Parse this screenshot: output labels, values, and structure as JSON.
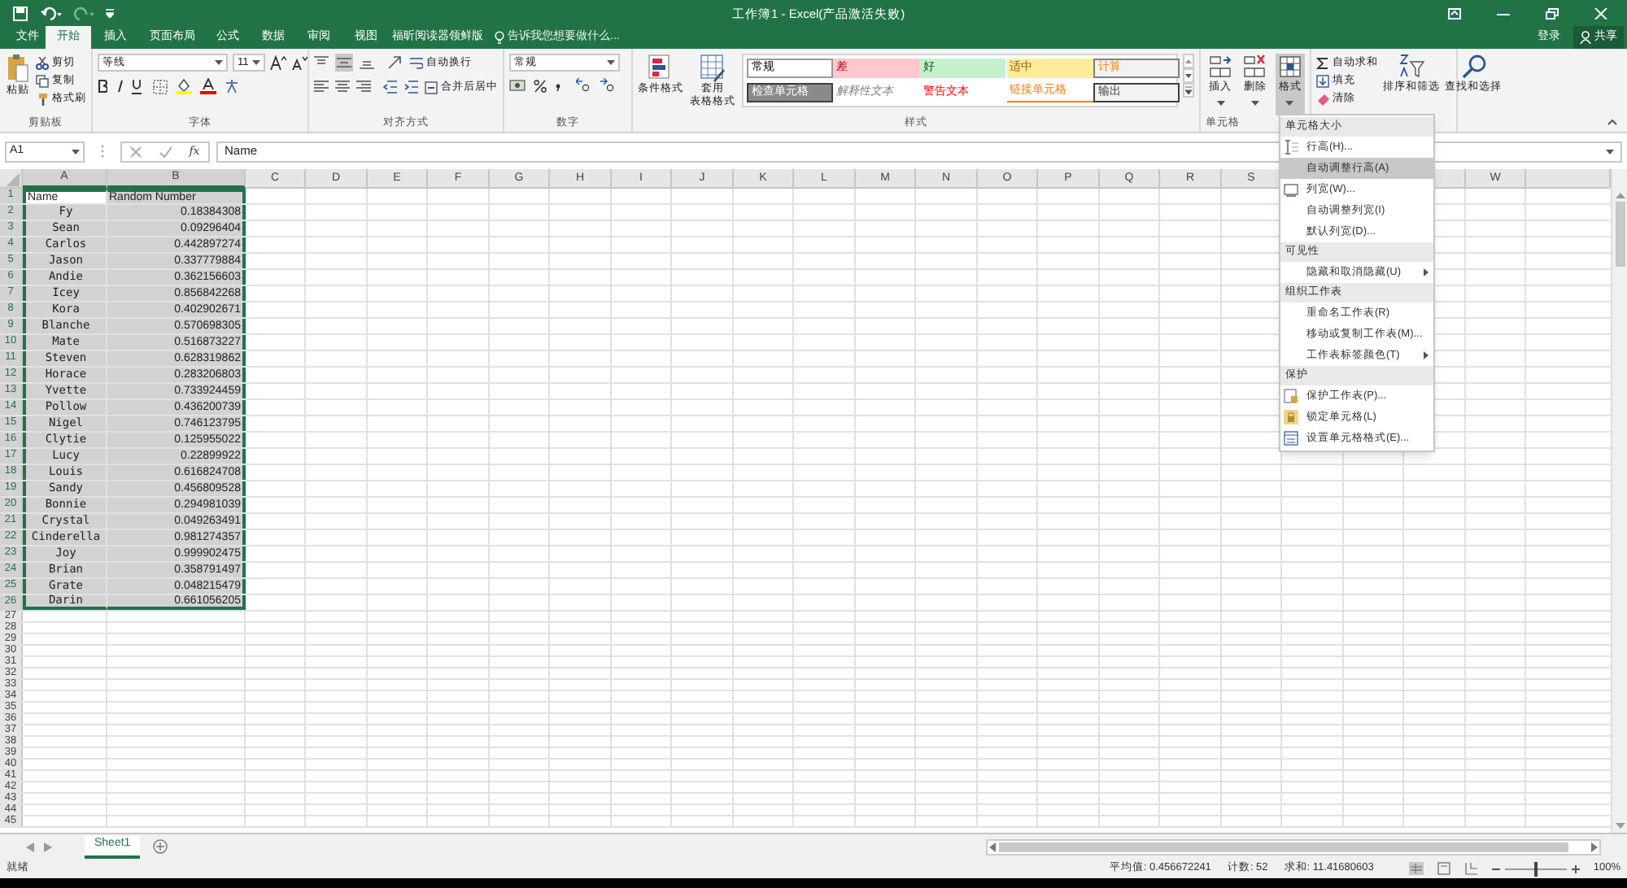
{
  "title_bar": {
    "title": "工作簿1 - Excel(产品激活失败)"
  },
  "menu_tabs": [
    {
      "label": "文件",
      "selected": false
    },
    {
      "label": "开始",
      "selected": true
    },
    {
      "label": "插入",
      "selected": false
    },
    {
      "label": "页面布局",
      "selected": false
    },
    {
      "label": "公式",
      "selected": false
    },
    {
      "label": "数据",
      "selected": false
    },
    {
      "label": "审阅",
      "selected": false
    },
    {
      "label": "视图",
      "selected": false
    },
    {
      "label": "福昕阅读器领鲜版",
      "selected": false
    }
  ],
  "tell_me": {
    "placeholder": "告诉我您想要做什么..."
  },
  "account": {
    "sign_in": "登录",
    "share": "共享"
  },
  "ribbon": {
    "clipboard": {
      "paste": "粘贴",
      "cut": "剪切",
      "copy": "复制",
      "format_painter": "格式刷",
      "label": "剪贴板"
    },
    "font": {
      "font_name": "等线",
      "font_size": "11",
      "label": "字体"
    },
    "alignment": {
      "wrap": "自动换行",
      "merge": "合并后居中",
      "label": "对齐方式"
    },
    "number": {
      "format": "常规",
      "label": "数字"
    },
    "styles": {
      "conditional": "条件格式",
      "table_format": [
        "套用",
        "表格格式"
      ],
      "label": "样式",
      "cell_styles": [
        {
          "label": "常规",
          "kind": "normal"
        },
        {
          "label": "差",
          "kind": "bad"
        },
        {
          "label": "好",
          "kind": "good"
        },
        {
          "label": "适中",
          "kind": "neutral"
        },
        {
          "label": "计算",
          "kind": "calculation"
        },
        {
          "label": "检查单元格",
          "kind": "check"
        },
        {
          "label": "解释性文本",
          "kind": "explanatory"
        },
        {
          "label": "警告文本",
          "kind": "warning"
        },
        {
          "label": "链接单元格",
          "kind": "linked"
        },
        {
          "label": "输出",
          "kind": "output"
        }
      ]
    },
    "cells": {
      "insert": "插入",
      "delete": "删除",
      "format": "格式",
      "label": "单元格"
    },
    "editing": {
      "autosum": "自动求和",
      "fill": "填充",
      "clear": "清除",
      "sort": "排序和筛选",
      "find": "查找和选择"
    }
  },
  "formula_bar": {
    "name_box": "A1",
    "fx": "fx",
    "value": "Name"
  },
  "sheet": {
    "columns": [
      "A",
      "B",
      "C",
      "D",
      "E",
      "F",
      "G",
      "H",
      "I",
      "J",
      "K",
      "L",
      "M",
      "N",
      "O",
      "P",
      "Q",
      "R",
      "S"
    ],
    "columns_right": [
      "W"
    ],
    "rows": [
      {
        "number": "1",
        "cells": [
          "Name",
          "Random Number"
        ],
        "selected": true
      },
      {
        "number": "2",
        "cells": [
          "Fy",
          "0.18384308"
        ],
        "selected": true
      },
      {
        "number": "3",
        "cells": [
          "Sean",
          "0.09296404"
        ],
        "selected": true
      },
      {
        "number": "4",
        "cells": [
          "Carlos",
          "0.442897274"
        ],
        "selected": true
      },
      {
        "number": "5",
        "cells": [
          "Jason",
          "0.337779884"
        ],
        "selected": true
      },
      {
        "number": "6",
        "cells": [
          "Andie",
          "0.362156603"
        ],
        "selected": true
      },
      {
        "number": "7",
        "cells": [
          "Icey",
          "0.856842268"
        ],
        "selected": true
      },
      {
        "number": "8",
        "cells": [
          "Kora",
          "0.402902671"
        ],
        "selected": true
      },
      {
        "number": "9",
        "cells": [
          "Blanche",
          "0.570698305"
        ],
        "selected": true
      },
      {
        "number": "10",
        "cells": [
          "Mate",
          "0.516873227"
        ],
        "selected": true
      },
      {
        "number": "11",
        "cells": [
          "Steven",
          "0.628319862"
        ],
        "selected": true
      },
      {
        "number": "12",
        "cells": [
          "Horace",
          "0.283206803"
        ],
        "selected": true
      },
      {
        "number": "13",
        "cells": [
          "Yvette",
          "0.733924459"
        ],
        "selected": true
      },
      {
        "number": "14",
        "cells": [
          "Pollow",
          "0.436200739"
        ],
        "selected": true
      },
      {
        "number": "15",
        "cells": [
          "Nigel",
          "0.746123795"
        ],
        "selected": true
      },
      {
        "number": "16",
        "cells": [
          "Clytie",
          "0.125955022"
        ],
        "selected": true
      },
      {
        "number": "17",
        "cells": [
          "Lucy",
          "0.22899922"
        ],
        "selected": true
      },
      {
        "number": "18",
        "cells": [
          "Louis",
          "0.616824708"
        ],
        "selected": true
      },
      {
        "number": "19",
        "cells": [
          "Sandy",
          "0.456809528"
        ],
        "selected": true
      },
      {
        "number": "20",
        "cells": [
          "Bonnie",
          "0.294981039"
        ],
        "selected": true
      },
      {
        "number": "21",
        "cells": [
          "Crystal",
          "0.049263491"
        ],
        "selected": true
      },
      {
        "number": "22",
        "cells": [
          "Cinderella",
          "0.981274357"
        ],
        "selected": true
      },
      {
        "number": "23",
        "cells": [
          "Joy",
          "0.999902475"
        ],
        "selected": true
      },
      {
        "number": "24",
        "cells": [
          "Brian",
          "0.358791497"
        ],
        "selected": true
      },
      {
        "number": "25",
        "cells": [
          "Grate",
          "0.048215479"
        ],
        "selected": true
      },
      {
        "number": "26",
        "cells": [
          "Darin",
          "0.661056205"
        ],
        "selected": true
      },
      {
        "number": "27",
        "selected": false
      },
      {
        "number": "28",
        "selected": false
      },
      {
        "number": "29",
        "selected": false
      },
      {
        "number": "30",
        "selected": false
      },
      {
        "number": "31",
        "selected": false
      },
      {
        "number": "32",
        "selected": false
      },
      {
        "number": "33",
        "selected": false
      },
      {
        "number": "34",
        "selected": false
      },
      {
        "number": "35",
        "selected": false
      },
      {
        "number": "36",
        "selected": false
      },
      {
        "number": "37",
        "selected": false
      },
      {
        "number": "38",
        "selected": false
      },
      {
        "number": "39",
        "selected": false
      },
      {
        "number": "40",
        "selected": false
      },
      {
        "number": "41",
        "selected": false
      },
      {
        "number": "42",
        "selected": false
      },
      {
        "number": "43",
        "selected": false
      },
      {
        "number": "44",
        "selected": false
      },
      {
        "number": "45",
        "selected": false
      }
    ]
  },
  "format_menu": [
    {
      "header": "单元格大小",
      "items": [
        {
          "label": "行高(H)...",
          "icon": true,
          "submenu": false,
          "selected": false
        },
        {
          "label": "自动调整行高(A)",
          "icon": false,
          "submenu": false,
          "selected": true
        },
        {
          "label": "列宽(W)...",
          "icon": true,
          "submenu": false,
          "selected": false
        },
        {
          "label": "自动调整列宽(I)",
          "icon": false,
          "submenu": false,
          "selected": false
        },
        {
          "label": "默认列宽(D)...",
          "icon": false,
          "submenu": false,
          "selected": false
        }
      ]
    },
    {
      "header": "可见性",
      "items": [
        {
          "label": "隐藏和取消隐藏(U)",
          "icon": false,
          "submenu": true,
          "selected": false
        }
      ]
    },
    {
      "header": "组织工作表",
      "items": [
        {
          "label": "重命名工作表(R)",
          "icon": false,
          "submenu": false,
          "selected": false
        },
        {
          "label": "移动或复制工作表(M)...",
          "icon": false,
          "submenu": false,
          "selected": false
        },
        {
          "label": "工作表标签颜色(T)",
          "icon": false,
          "submenu": true,
          "selected": false
        }
      ]
    },
    {
      "header": "保护",
      "items": [
        {
          "label": "保护工作表(P)...",
          "icon": true,
          "submenu": false,
          "selected": false
        },
        {
          "label": "锁定单元格(L)",
          "icon": true,
          "submenu": false,
          "selected": false
        },
        {
          "label": "设置单元格格式(E)...",
          "icon": true,
          "submenu": false,
          "selected": false
        }
      ]
    }
  ],
  "sheet_tabs": [
    {
      "label": "Sheet1",
      "selected": true
    }
  ],
  "status_bar": {
    "ready": "就绪",
    "average": "平均值: 0.456672241",
    "count": "计数: 52",
    "sum": "求和: 11.41680603",
    "zoom": "100%",
    "zoom_slider": {
      "level": 0.5
    }
  }
}
